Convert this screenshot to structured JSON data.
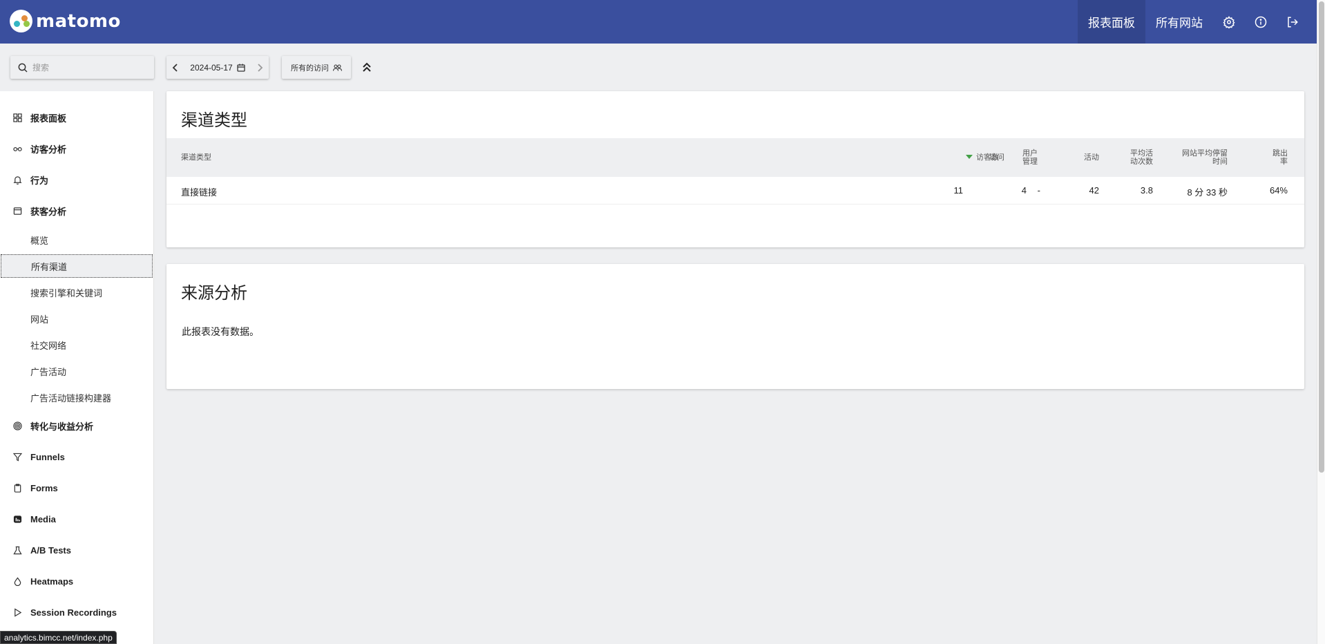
{
  "app": {
    "logo_text": "matomo"
  },
  "topnav": {
    "links": [
      {
        "label": "报表面板",
        "active": true
      },
      {
        "label": "所有网站",
        "active": false
      }
    ],
    "icons": [
      "gear-icon",
      "info-icon",
      "logout-icon"
    ]
  },
  "toolbar": {
    "search_placeholder": "搜索",
    "date": "2024-05-17",
    "segment": "所有的访问"
  },
  "sidebar": {
    "categories": [
      {
        "label": "报表面板",
        "icon": "grid-icon"
      },
      {
        "label": "访客分析",
        "icon": "glasses-icon"
      },
      {
        "label": "行为",
        "icon": "bell-icon"
      },
      {
        "label": "获客分析",
        "icon": "window-icon"
      }
    ],
    "acquisition_items": [
      {
        "label": "概览",
        "active": false
      },
      {
        "label": "所有渠道",
        "active": true
      },
      {
        "label": "搜索引擎和关键词",
        "active": false
      },
      {
        "label": "网站",
        "active": false
      },
      {
        "label": "社交网络",
        "active": false
      },
      {
        "label": "广告活动",
        "active": false
      },
      {
        "label": "广告活动链接构建器",
        "active": false
      }
    ],
    "more_categories": [
      {
        "label": "转化与收益分析",
        "icon": "target-icon"
      },
      {
        "label": "Funnels",
        "icon": "funnel-icon"
      },
      {
        "label": "Forms",
        "icon": "clipboard-icon"
      },
      {
        "label": "Media",
        "icon": "media-icon"
      },
      {
        "label": "A/B Tests",
        "icon": "flask-icon"
      },
      {
        "label": "Heatmaps",
        "icon": "drop-icon"
      },
      {
        "label": "Session Recordings",
        "icon": "play-icon"
      }
    ]
  },
  "channel_report": {
    "title": "渠道类型",
    "columns": {
      "label": "渠道类型",
      "visits": "访问",
      "visitors": "访客数",
      "users_l1": "用户",
      "users_l2": "管理",
      "actions": "活动",
      "avg_actions_l1": "平均活",
      "avg_actions_l2": "动次数",
      "avg_time_l1": "网站平均停留",
      "avg_time_l2": "时间",
      "bounce_l1": "跳出",
      "bounce_l2": "率"
    },
    "sorted_column": "visitors",
    "sort_color": "#43a047",
    "rows": [
      {
        "label": "直接链接",
        "visits": "11",
        "visitors": "4",
        "users": "-",
        "actions": "42",
        "avg_actions": "3.8",
        "avg_time": "8 分 33 秒",
        "bounce": "64%"
      }
    ]
  },
  "referrers_report": {
    "title": "来源分析",
    "empty_message": "此报表没有数据。"
  },
  "status_bar": {
    "url": "analytics.bimcc.net/index.php"
  }
}
